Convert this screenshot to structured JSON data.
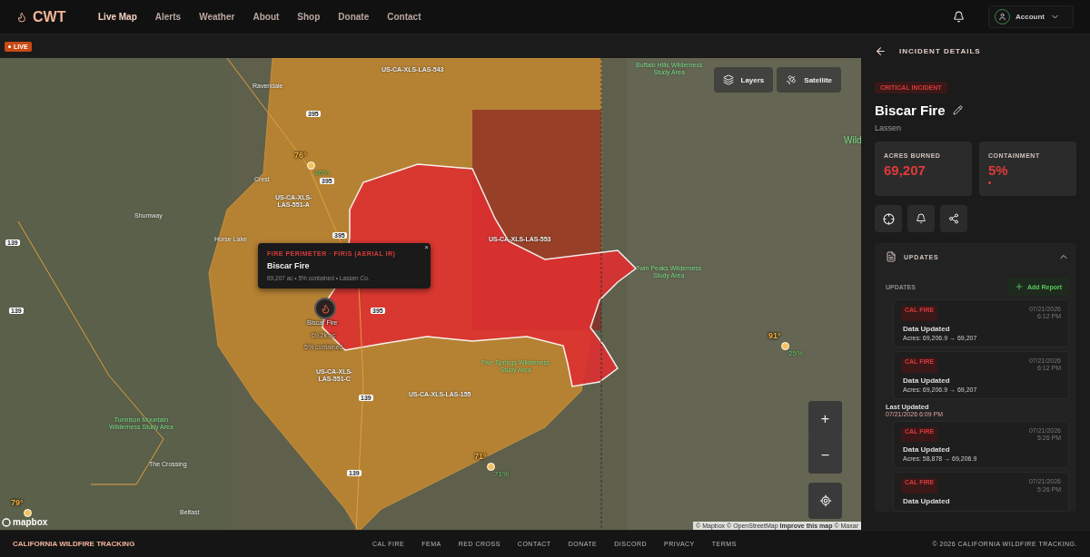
{
  "header": {
    "brand": "CWT",
    "nav": [
      {
        "label": "Live Map",
        "selected": true
      },
      {
        "label": "Alerts",
        "selected": false
      },
      {
        "label": "Weather",
        "selected": false
      },
      {
        "label": "About",
        "selected": false
      },
      {
        "label": "Shop",
        "selected": false
      },
      {
        "label": "Donate",
        "selected": false
      },
      {
        "label": "Contact",
        "selected": false
      }
    ],
    "account": "Account"
  },
  "live_badge": "LIVE",
  "map": {
    "controls": [
      "Layers",
      "Satellite"
    ],
    "zoom_in": "+",
    "zoom_out": "−",
    "places": [
      {
        "kind": "town",
        "text": "Ravendale"
      },
      {
        "kind": "zone",
        "text": "US-CA-XLS-LAS-543"
      },
      {
        "kind": "town",
        "text": "Crest"
      },
      {
        "kind": "zone",
        "text": "US-CA-XLS-\nLAS-551-A"
      },
      {
        "kind": "town",
        "text": "Shumway"
      },
      {
        "kind": "town",
        "text": "Horse Lake"
      },
      {
        "kind": "zone",
        "text": "US-CA-XLS-LAS-553"
      },
      {
        "kind": "wild",
        "text": "Twin Peaks Wilderness\nStudy Area"
      },
      {
        "kind": "wild",
        "text": "Five Springs Wilderness\nStudy Area"
      },
      {
        "kind": "zone",
        "text": "US-CA-XLS-\nLAS-551-C"
      },
      {
        "kind": "zone",
        "text": "US-CA-XLS-LAS-155"
      },
      {
        "kind": "wild",
        "text": "Tunnison Mountain\nWilderness Study Area"
      },
      {
        "kind": "town",
        "text": "The Crossing"
      },
      {
        "kind": "town",
        "text": "Belfast"
      },
      {
        "kind": "wild",
        "text": "Buffalo Hills Wilderness\nStudy Area"
      },
      {
        "kind": "edge",
        "text": "Wild"
      }
    ],
    "shields": [
      "395",
      "395",
      "395",
      "395",
      "139",
      "139",
      "139",
      "139"
    ],
    "weather": [
      {
        "temp": "76°",
        "humidity": "46%"
      },
      {
        "temp": "71°",
        "humidity": "71%"
      },
      {
        "temp": "91°",
        "humidity": "25%"
      },
      {
        "temp": "79°"
      }
    ],
    "fire_marker": {
      "name": "Biscar Fire",
      "acres": "69.2k ac",
      "contained": "5% contained"
    },
    "popup": {
      "source": "FIRE PERIMETER · FIRIS (AERIAL IR)",
      "title": "Biscar Fire",
      "summary": "69,207 ac • 5% contained • Lassen Co.",
      "close": "×"
    },
    "logo": "mapbox",
    "attribution": "© Mapbox © OpenStreetMap",
    "attribution_link": "Improve this map",
    "attribution_tail": "© Maxar"
  },
  "panel": {
    "heading": "INCIDENT DETAILS",
    "badge": "CRITICAL INCIDENT",
    "title": "Biscar Fire",
    "county": "Lassen",
    "stats": [
      {
        "label": "ACRES BURNED",
        "value": "69,207"
      },
      {
        "label": "CONTAINMENT",
        "value": "5%",
        "level": 0.05
      }
    ],
    "updates": {
      "title": "UPDATES",
      "expanded": true,
      "subtitle": "UPDATES",
      "add": "Add Report",
      "feed": [
        {
          "kind": "update",
          "source": "CAL FIRE",
          "date": "07/21/2026",
          "time": "6:12 PM",
          "title": "Data Updated",
          "detail": "Acres: 69,206.9 → 69,207"
        },
        {
          "kind": "update",
          "source": "CAL FIRE",
          "date": "07/21/2026",
          "time": "6:12 PM",
          "title": "Data Updated",
          "detail": "Acres: 69,206.9 → 69,207"
        },
        {
          "kind": "marker",
          "title": "Last Updated",
          "date": "07/21/2026 6:09 PM"
        },
        {
          "kind": "update",
          "source": "CAL FIRE",
          "date": "07/21/2026",
          "time": "5:26 PM",
          "title": "Data Updated",
          "detail": "Acres: 58,878 → 69,206.9"
        },
        {
          "kind": "update",
          "source": "CAL FIRE",
          "date": "07/21/2026",
          "time": "5:26 PM",
          "title": "Data Updated"
        }
      ]
    }
  },
  "footer": {
    "brand": "CALIFORNIA WILDFIRE TRACKING",
    "links": [
      "CAL FIRE",
      "FEMA",
      "RED CROSS",
      "CONTACT",
      "DONATE",
      "DISCORD",
      "PRIVACY",
      "TERMS"
    ],
    "copyright": "© 2026 CALIFORNIA WILDFIRE TRACKING."
  }
}
